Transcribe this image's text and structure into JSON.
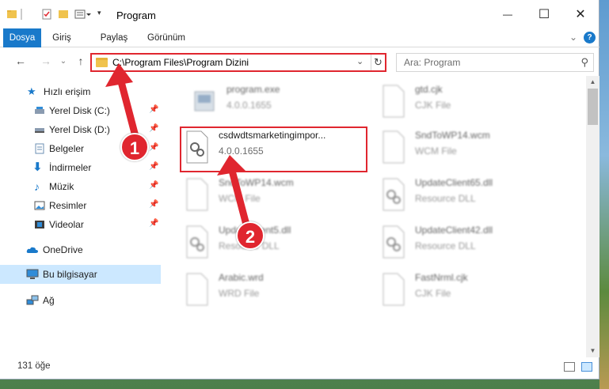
{
  "window": {
    "title": "Program",
    "minimize_glyph": "—",
    "maximize_glyph": "☐",
    "close_glyph": "✕"
  },
  "ribbon": {
    "tabs": [
      "Dosya",
      "Giriş",
      "Paylaş",
      "Görünüm"
    ],
    "active_tab": "Dosya",
    "expand_glyph": "⌄",
    "help_glyph": "?"
  },
  "navigation": {
    "back_glyph": "←",
    "forward_glyph": "→",
    "recent_glyph": "⌄",
    "up_glyph": "↑",
    "address_path": "C:\\Program Files\\Program Dizini",
    "address_dropdown_glyph": "⌄",
    "refresh_glyph": "↻",
    "search_placeholder": "Ara: Program",
    "search_glyph": "⚲"
  },
  "sidebar": {
    "items": [
      {
        "label": "Hızlı erişim",
        "icon": "star-icon",
        "pinned": false
      },
      {
        "label": "Yerel Disk (C:)",
        "icon": "drive-icon",
        "pinned": true
      },
      {
        "label": "Yerel Disk (D:)",
        "icon": "drive-icon",
        "pinned": true
      },
      {
        "label": "Belgeler",
        "icon": "documents-icon",
        "pinned": true
      },
      {
        "label": "İndirmeler",
        "icon": "download-icon",
        "pinned": true
      },
      {
        "label": "Müzik",
        "icon": "music-icon",
        "pinned": true
      },
      {
        "label": "Resimler",
        "icon": "pictures-icon",
        "pinned": true
      },
      {
        "label": "Videolar",
        "icon": "videos-icon",
        "pinned": true
      },
      {
        "label": "OneDrive",
        "icon": "cloud-icon",
        "pinned": false
      },
      {
        "label": "Bu bilgisayar",
        "icon": "computer-icon",
        "pinned": false,
        "selected": true
      },
      {
        "label": "Ağ",
        "icon": "network-icon",
        "pinned": false
      }
    ],
    "pin_glyph": "📌"
  },
  "files": [
    {
      "name": "program.exe",
      "type": "4.0.0.1655",
      "blurred": true
    },
    {
      "name": "gtd.cjk",
      "type": "CJK File",
      "blurred": true
    },
    {
      "name": "csdwdtsmarketingimpor...",
      "type": "4.0.0.1655",
      "blurred": false,
      "highlighted": true
    },
    {
      "name": "SndToWP14.wcm",
      "type": "WCM File",
      "blurred": true
    },
    {
      "name": "SndToWP14.wcm",
      "type": "WCM File",
      "blurred": true
    },
    {
      "name": "UpdateClient65.dll",
      "type": "Resource DLL",
      "blurred": true
    },
    {
      "name": "UpdateClient5.dll",
      "type": "Resource DLL",
      "blurred": true
    },
    {
      "name": "UpdateClient42.dll",
      "type": "Resource DLL",
      "blurred": true
    },
    {
      "name": "Arabic.wrd",
      "type": "WRD File",
      "blurred": true
    },
    {
      "name": "FastNrml.cjk",
      "type": "CJK File",
      "blurred": true
    }
  ],
  "annotations": {
    "step1": "1",
    "step2": "2",
    "color": "#e0262f"
  },
  "status": {
    "item_count": "131 öğe"
  },
  "scrollbar": {
    "up_glyph": "▲",
    "down_glyph": "▼"
  }
}
